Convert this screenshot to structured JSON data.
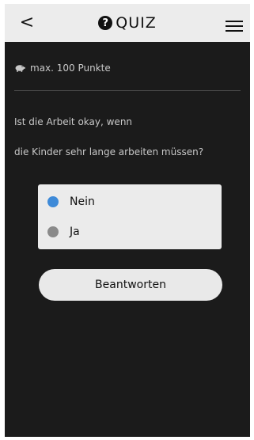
{
  "header": {
    "back_label": "<",
    "title_icon": "?",
    "title": "QUIZ"
  },
  "points": {
    "text": "max. 100 Punkte"
  },
  "question": {
    "line1": "Ist die Arbeit okay, wenn",
    "line2": "die Kinder sehr lange arbeiten müssen?"
  },
  "options": [
    {
      "label": "Nein",
      "selected": true
    },
    {
      "label": "Ja",
      "selected": false
    }
  ],
  "submit_label": "Beantworten",
  "colors": {
    "background": "#1b1b1b",
    "header": "#ececec",
    "selected_radio": "#3e8ad8",
    "unselected_radio": "#8a8a8a"
  }
}
